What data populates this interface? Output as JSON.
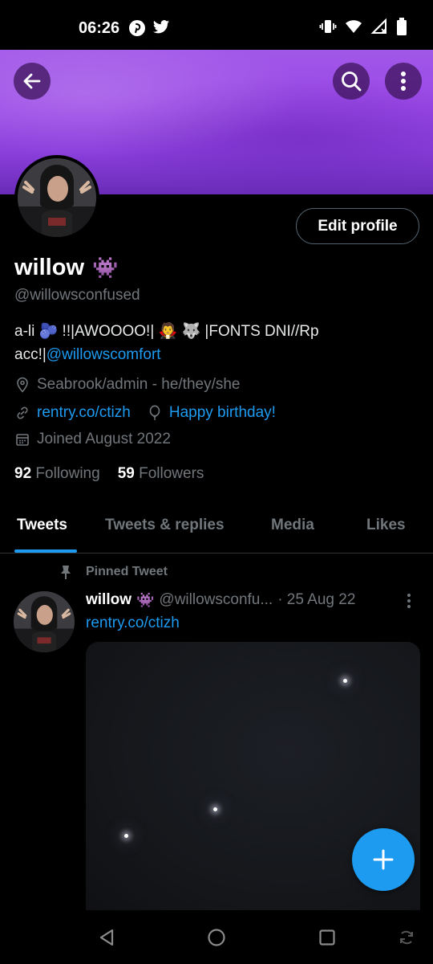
{
  "status_bar": {
    "time": "06:26",
    "app_icons": [
      "pinterest-icon",
      "twitter-icon"
    ],
    "system_icons": [
      "vibrate-icon",
      "wifi-icon",
      "no-signal-icon",
      "battery-icon"
    ]
  },
  "header": {
    "back_icon": "arrow-left-icon",
    "search_icon": "search-icon",
    "more_icon": "more-vertical-icon",
    "banner_color": "#9a48e6"
  },
  "profile": {
    "edit_button": "Edit profile",
    "display_name": "willow",
    "name_emoji": "👾",
    "handle": "@willowsconfused",
    "bio_text": "a-li 🫐 !!|AWOOOO!| 🧛 🐺 |FONTS DNI//Rp acc!|",
    "bio_link": "@willowscomfort",
    "location": "Seabrook/admin - he/they/she",
    "website": "rentry.co/ctizh",
    "birthday": "Happy birthday!",
    "joined": "Joined August 2022",
    "following_count": "92",
    "following_label": "Following",
    "followers_count": "59",
    "followers_label": "Followers"
  },
  "tabs": [
    {
      "label": "Tweets",
      "active": true
    },
    {
      "label": "Tweets & replies",
      "active": false
    },
    {
      "label": "Media",
      "active": false
    },
    {
      "label": "Likes",
      "active": false
    }
  ],
  "tweet": {
    "pinned_label": "Pinned Tweet",
    "name": "willow",
    "name_emoji": "👾",
    "handle": "@willowsconfu...",
    "date": "· 25 Aug 22",
    "text_link": "rentry.co/ctizh"
  },
  "fab": {
    "icon": "plus-icon"
  },
  "colors": {
    "accent": "#1d9bf0",
    "background": "#000000",
    "muted": "#71767b"
  }
}
